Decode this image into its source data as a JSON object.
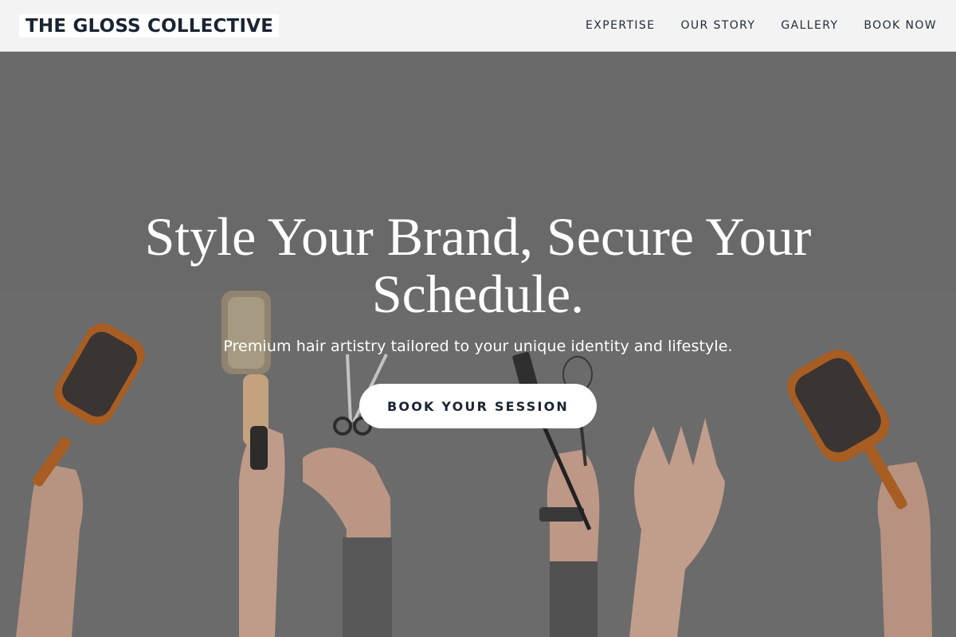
{
  "header": {
    "logo": "THE GLOSS COLLECTIVE",
    "nav": [
      {
        "label": "EXPERTISE"
      },
      {
        "label": "OUR STORY"
      },
      {
        "label": "GALLERY"
      },
      {
        "label": "BOOK NOW"
      }
    ]
  },
  "hero": {
    "title": "Style Your Brand, Secure Your Schedule.",
    "subtitle": "Premium hair artistry tailored to your unique identity and lifestyle.",
    "cta_label": "BOOK YOUR SESSION",
    "image_description_icons": [
      "paddle-brush-icon",
      "round-brush-icon",
      "scissors-icon",
      "tint-brush-icon",
      "whisk-icon",
      "hand-icon"
    ]
  },
  "colors": {
    "header_bg": "#f3f3f3",
    "brand_text": "#1a2433",
    "hero_overlay": "#6f6f6f",
    "cta_bg": "#ffffff"
  }
}
